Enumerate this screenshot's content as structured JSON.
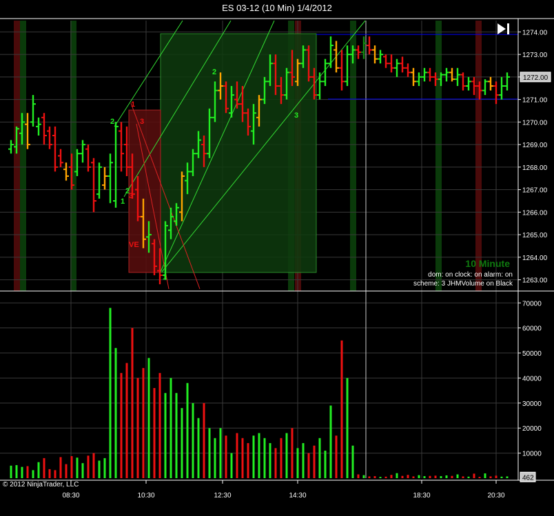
{
  "window": {
    "title": "ES 03-12 (10 Min)  1/4/2012"
  },
  "copyright": "© 2012 NinjaTrader, LLC",
  "play_icon": "skip-to-end-icon",
  "info": {
    "period": "10 Minute",
    "status_line": "dom: on clock: on alarm: on",
    "scheme_line": "scheme: 3 JHMVolume on Black"
  },
  "colors": {
    "background": "#000000",
    "grid": "#3a3a3a",
    "axis": "#ffffff",
    "up": "#22ee22",
    "up_dark": "#128a12",
    "down": "#ee1111",
    "neutral": "#ffa500",
    "green_box": "#0e3b0e",
    "red_box": "#5a0e0e",
    "range_lines": "#0000ff",
    "period_label": "#0f7a0f"
  },
  "chart_data": [
    {
      "type": "bar",
      "title": "",
      "subtitle": "",
      "y_axis": {
        "min": 1262.5,
        "max": 1274.5,
        "ticks": [
          1263.0,
          1264.0,
          1265.0,
          1266.0,
          1267.0,
          1268.0,
          1269.0,
          1270.0,
          1271.0,
          1272.0,
          1273.0,
          1274.0
        ]
      },
      "current_price": "1272.00",
      "x_tick_labels": [
        "08:30",
        "10:30",
        "12:30",
        "14:30",
        "18:30",
        "20:30"
      ],
      "grid": true,
      "annotations": [
        "1",
        "2",
        "3",
        "1",
        "2",
        "3",
        "1",
        "2",
        "3",
        "VE"
      ]
    },
    {
      "type": "bar",
      "title": "",
      "y_axis": {
        "min": 0,
        "max": 72000,
        "ticks": [
          10000,
          20000,
          30000,
          40000,
          50000,
          60000,
          70000
        ]
      },
      "current_volume": "462",
      "volume": [
        5000,
        5200,
        4500,
        4800,
        3200,
        6400,
        8000,
        3600,
        3200,
        8400,
        5600,
        8800,
        8200,
        6000,
        9000,
        10000,
        7000,
        8000,
        68000,
        52000,
        42000,
        46000,
        60000,
        40000,
        44000,
        48000,
        36000,
        42000,
        34000,
        40000,
        34000,
        28000,
        38000,
        30000,
        24000,
        30000,
        20000,
        16000,
        20000,
        17000,
        10000,
        18000,
        16000,
        14000,
        17000,
        18000,
        16000,
        14000,
        12000,
        16000,
        18000,
        20000,
        12000,
        14000,
        10000,
        13000,
        16000,
        11000,
        29000,
        17000,
        55000,
        40000,
        13000,
        1500,
        1200,
        700,
        800,
        500,
        600,
        1300,
        2000,
        900,
        1300,
        700,
        1200,
        800,
        900,
        1000,
        800,
        1100,
        900,
        1500,
        700,
        600,
        1800,
        500,
        1900,
        700,
        1000,
        600,
        700
      ]
    }
  ]
}
